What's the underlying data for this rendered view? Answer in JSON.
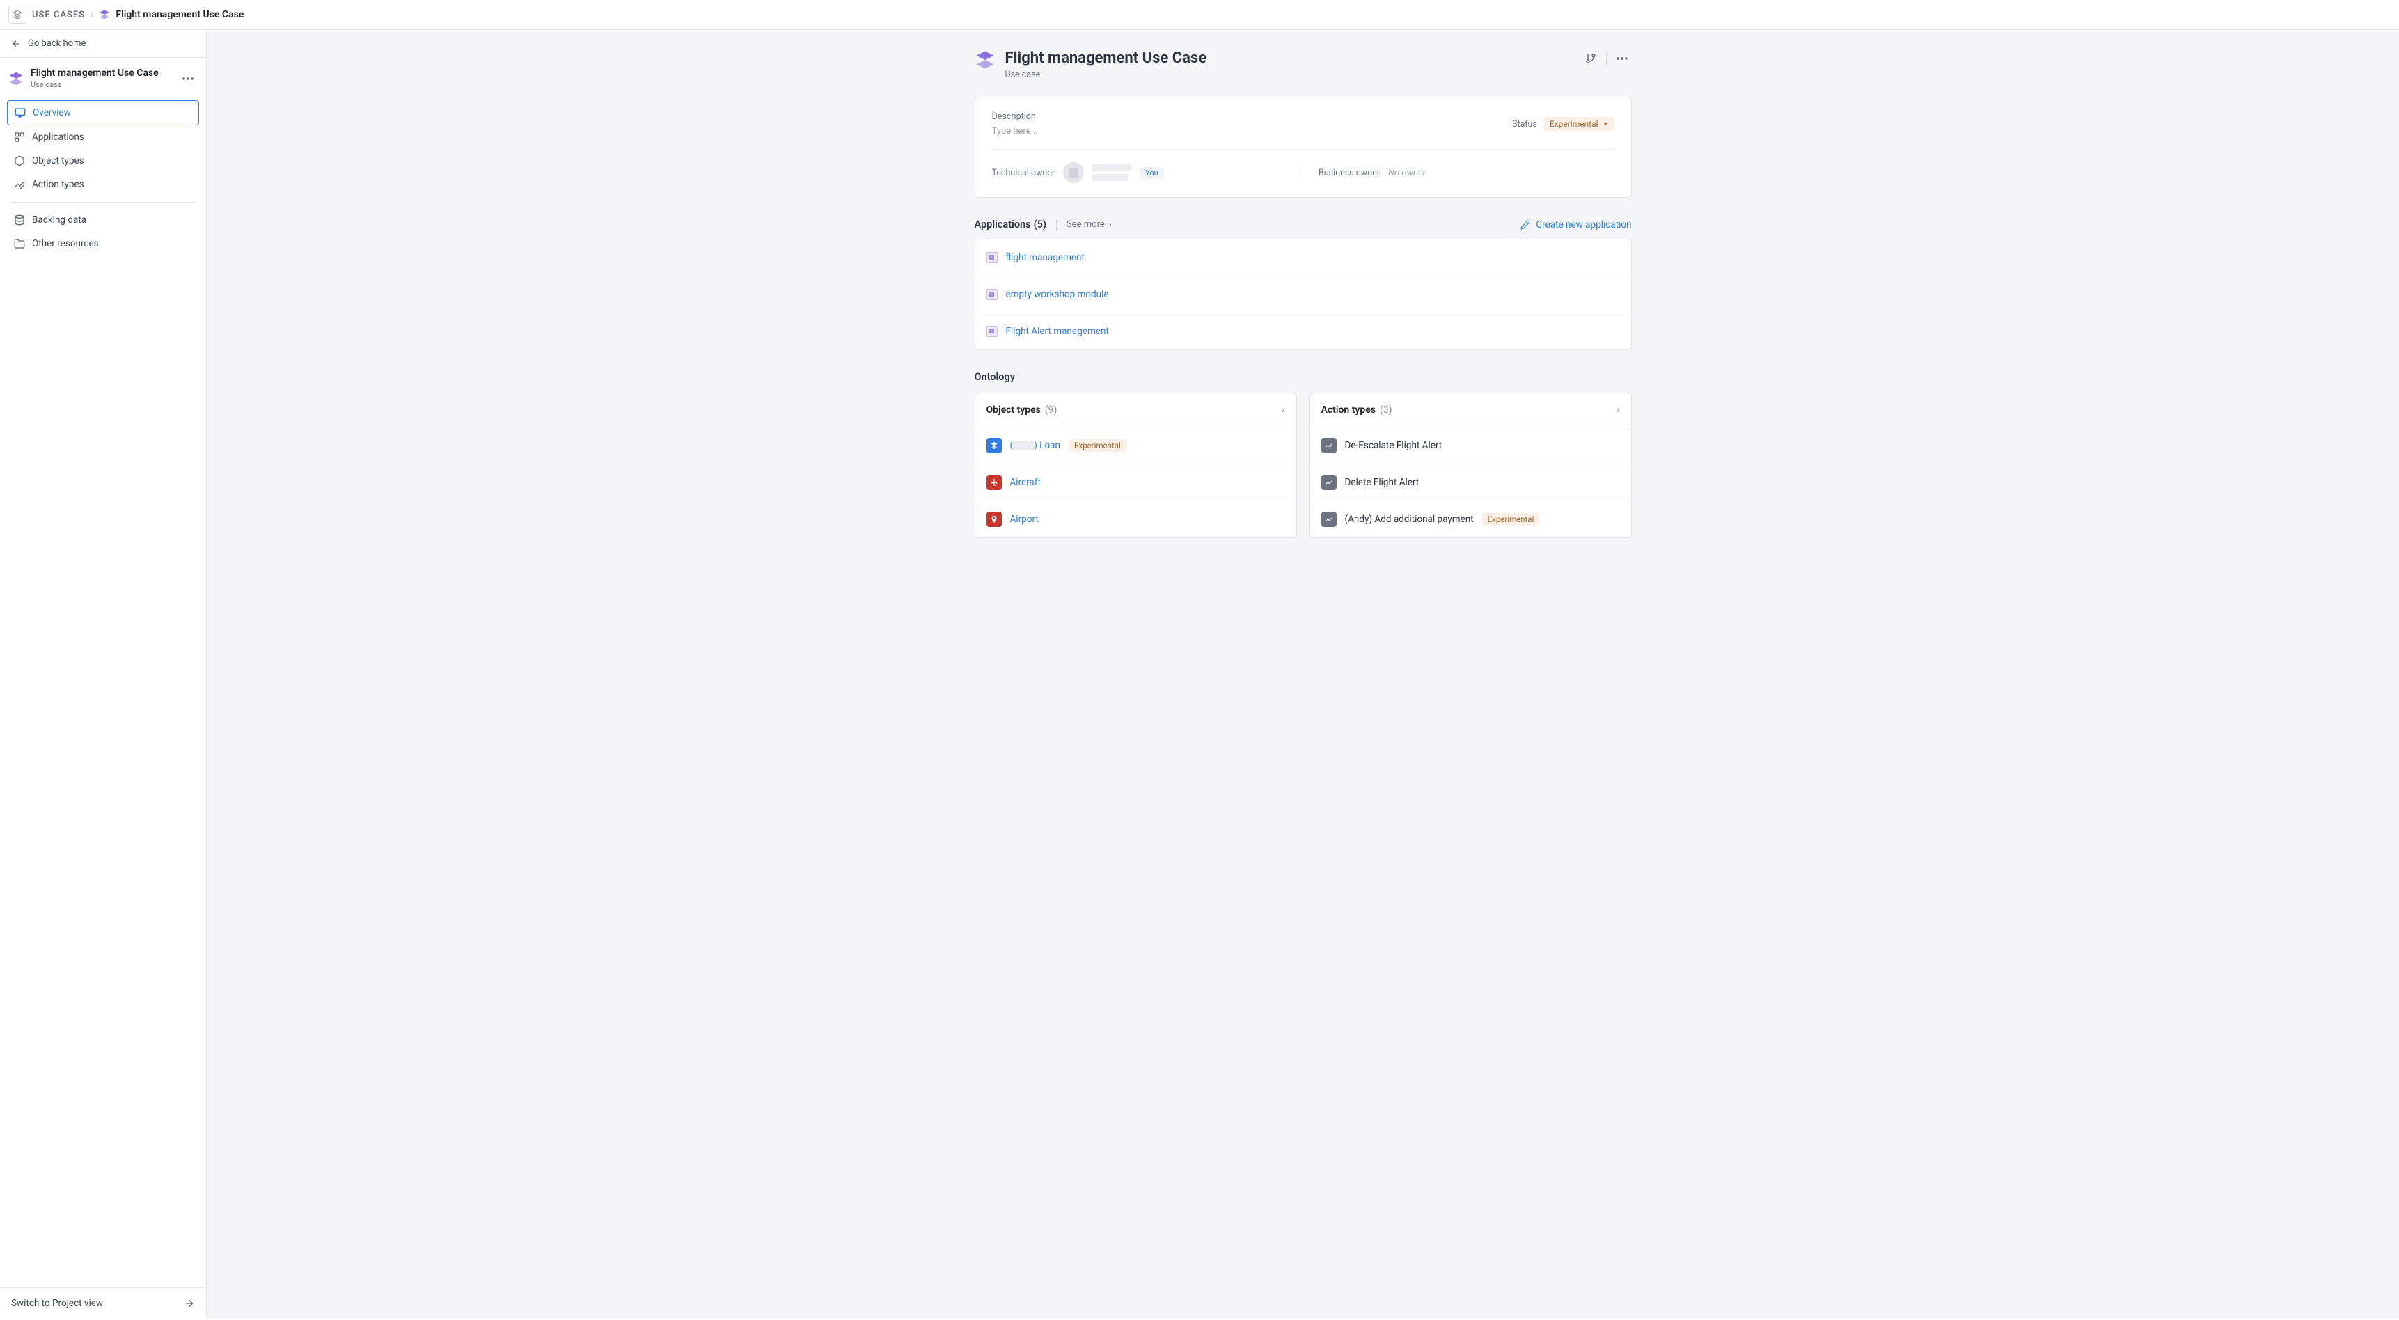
{
  "breadcrumb": {
    "root": "USE CASES",
    "current": "Flight management Use Case"
  },
  "goBack": "Go back home",
  "sideHeader": {
    "title": "Flight management Use Case",
    "subtitle": "Use case"
  },
  "nav": {
    "overview": "Overview",
    "applications": "Applications",
    "objectTypes": "Object types",
    "actionTypes": "Action types",
    "backingData": "Backing data",
    "otherResources": "Other resources"
  },
  "switchView": "Switch to Project view",
  "page": {
    "title": "Flight management Use Case",
    "subtitle": "Use case"
  },
  "desc": {
    "label": "Description",
    "placeholder": "Type here...",
    "statusLabel": "Status",
    "statusValue": "Experimental",
    "techOwnerLabel": "Technical owner",
    "youBadge": "You",
    "bizOwnerLabel": "Business owner",
    "noOwner": "No owner"
  },
  "apps": {
    "title": "Applications",
    "count": "(5)",
    "seeMore": "See more",
    "create": "Create new application",
    "items": [
      "flight management",
      "empty workshop module",
      "Flight Alert management"
    ]
  },
  "ontology": {
    "title": "Ontology",
    "objectTypes": {
      "title": "Object types",
      "count": "(9)",
      "items": [
        {
          "prefix": "(",
          "suffix": ") Loan",
          "badge": "Experimental",
          "iconColor": "blue",
          "glyph": "cube"
        },
        {
          "name": "Aircraft",
          "iconColor": "redc",
          "glyph": "plane"
        },
        {
          "name": "Airport",
          "iconColor": "redc",
          "glyph": "pin"
        }
      ]
    },
    "actionTypes": {
      "title": "Action types",
      "count": "(3)",
      "items": [
        {
          "name": "De-Escalate Flight Alert"
        },
        {
          "name": "Delete Flight Alert"
        },
        {
          "name": "(Andy) Add additional payment",
          "badge": "Experimental"
        }
      ]
    }
  }
}
